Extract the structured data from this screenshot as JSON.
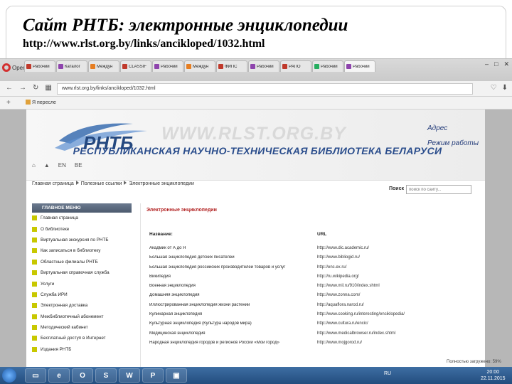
{
  "slide": {
    "title": "Сайт РНТБ: электронные энциклопедии",
    "url": "http://www.rlst.org.by/links/ancikloped/1032.html"
  },
  "browser": {
    "menu_label": "Opera",
    "tabs": [
      "Рабочий",
      "Каталог",
      "Междун",
      "CLASSIF",
      "Рабочий",
      "Междун",
      "ФИПС",
      "Рабочий",
      "РАПО",
      "Рабочий",
      "Рабочий"
    ],
    "address": "www.rlst.org.by/links/ancikloped/1032.html",
    "bookmark": "Я пересле"
  },
  "site": {
    "watermark": "WWW.RLST.ORG.BY",
    "slogan": "РЕСПУБЛИКАНСКАЯ НАУЧНО-ТЕХНИЧЕСКАЯ БИБЛИОТЕКА БЕЛАРУСИ",
    "links": [
      "Адрес",
      "Режим работы"
    ],
    "lang": [
      "EN",
      "BE"
    ],
    "breadcrumbs": [
      "Главная страница",
      "Полезные ссылки",
      "Электронные энциклопедии"
    ],
    "search_label": "Поиск",
    "search_placeholder": "поиск по сайту...",
    "menu_title": "ГЛАВНОЕ МЕНЮ",
    "menu": [
      "Главная страница",
      "О библиотеке",
      "Виртуальная экскурсия по РНТБ",
      "Как записаться в библиотеку",
      "Областные филиалы РНТБ",
      "Виртуальная справочная служба",
      "Услуги",
      "Служба ИРИ",
      "Электронная доставка",
      "Межбиблиотечный абонемент",
      "Методический кабинет",
      "Бесплатный доступ в Интернет",
      "Издания РНТБ"
    ],
    "content_title": "Электронные энциклопедии",
    "col_name": "Название:",
    "col_url": "URL",
    "rows": [
      {
        "name": "Акадмик от А до Я",
        "url": "http://www.dic.academic.ru/"
      },
      {
        "name": "Большая энциклопедия детских писателей",
        "url": "http://www.bibliogid.ru/"
      },
      {
        "name": "Большая энциклопедия российских производителей товаров и услуг",
        "url": "http://enc.ex.ru/"
      },
      {
        "name": "Википедия",
        "url": "http://ru.wikipedia.org/"
      },
      {
        "name": "Военная энциклопедия",
        "url": "http://www.mil.ru/910/index.shtml"
      },
      {
        "name": "Домашняя энциклопедия",
        "url": "http://www.zonna.com/"
      },
      {
        "name": "Иллюстрированная энциклопедия жизни растений",
        "url": "http://aquaflora.narod.ru/"
      },
      {
        "name": "Кулинарная энциклопедия",
        "url": "http://www.cooking.ru/interesting/enciklopedia/"
      },
      {
        "name": "Культурная энциклопедия (Культура народов мира)",
        "url": "http://www.cultura.ru/encic/"
      },
      {
        "name": "Медицинская энциклопедия",
        "url": "http://www.medicalbrowser.ru/index.shtml"
      },
      {
        "name": "Народная энциклопедия городов и регионов России «Мой город»",
        "url": "http://www.mojgorod.ru/"
      }
    ]
  },
  "status": "Полностью загружено: 59%",
  "taskbar": {
    "tray": "RU",
    "time": "20:00",
    "date": "22.11.2015"
  },
  "colors": {
    "accent": "#2a4d8c",
    "menu_bullet": "#c8c800",
    "title_red": "#b22222"
  }
}
